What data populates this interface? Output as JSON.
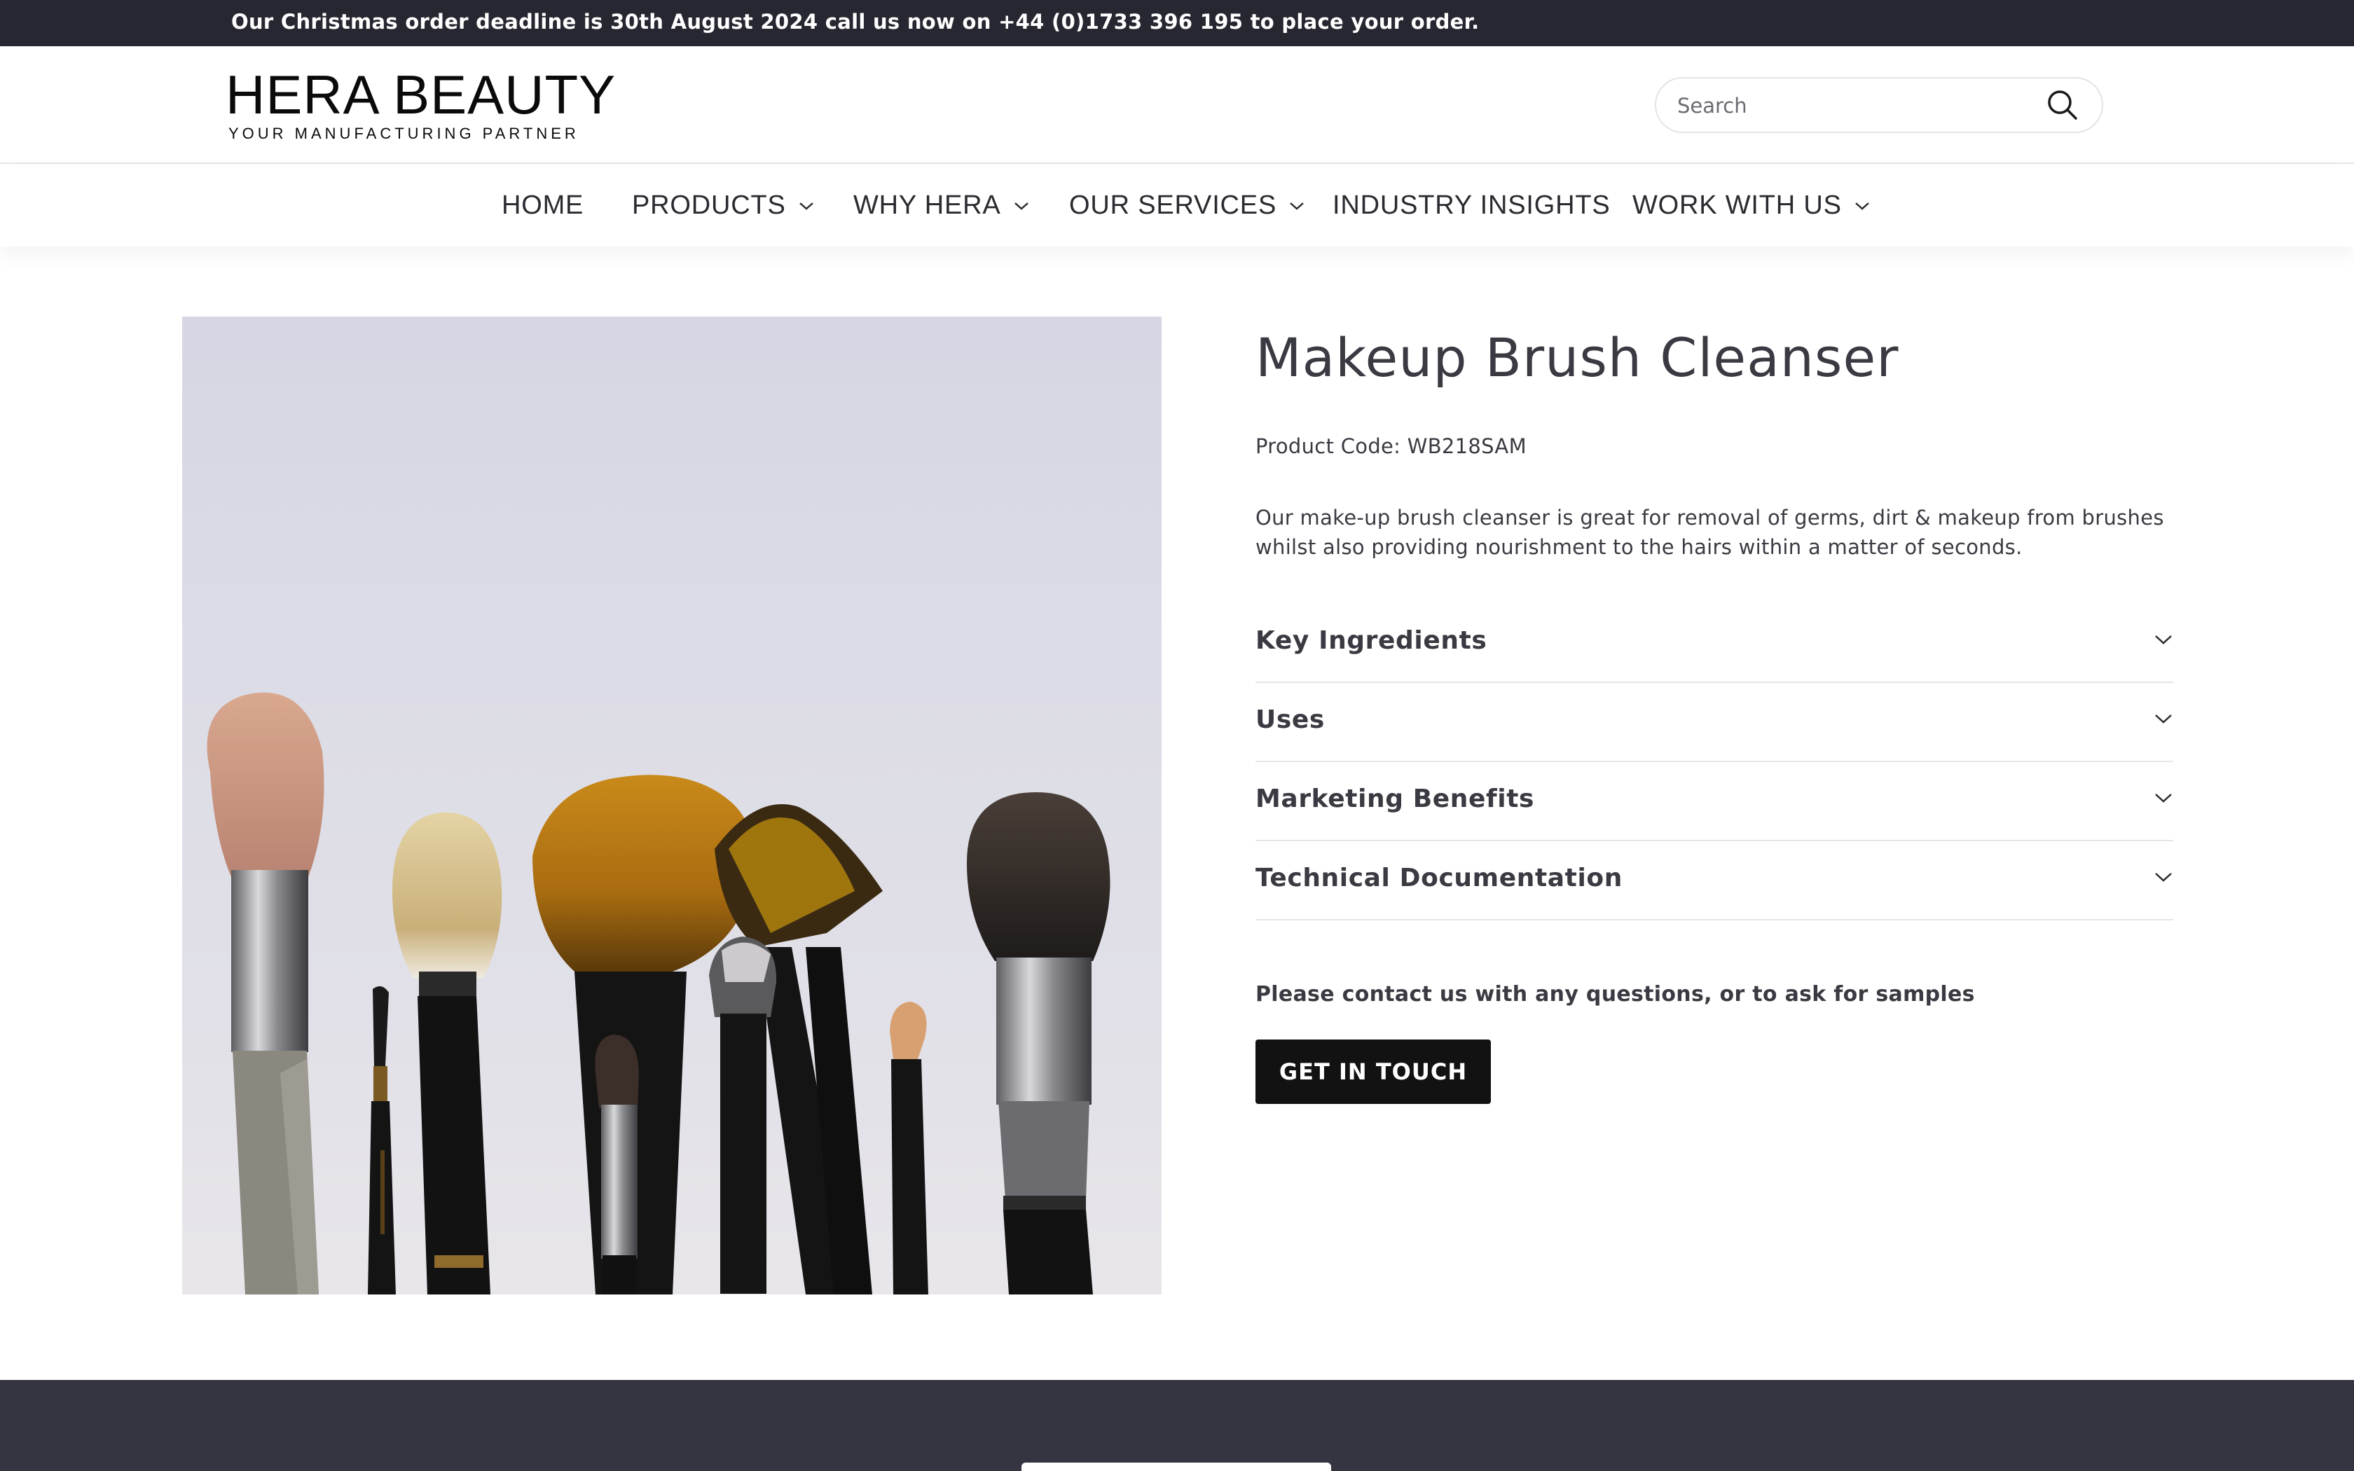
{
  "announcement": {
    "text": "Our Christmas order deadline is 30th August 2024 call us now on +44 (0)1733 396 195 to place your order."
  },
  "header": {
    "logo_main": "HERA BEAUTY",
    "logo_sub": "YOUR MANUFACTURING PARTNER",
    "search_placeholder": "Search",
    "search_icon": "search-icon"
  },
  "nav": {
    "items": [
      {
        "label": "HOME",
        "has_dropdown": false
      },
      {
        "label": "PRODUCTS",
        "has_dropdown": true
      },
      {
        "label": "WHY HERA",
        "has_dropdown": true
      },
      {
        "label": "OUR SERVICES",
        "has_dropdown": true
      },
      {
        "label": "INDUSTRY INSIGHTS",
        "has_dropdown": false
      },
      {
        "label": "WORK WITH US",
        "has_dropdown": true
      }
    ]
  },
  "product": {
    "title": "Makeup Brush Cleanser",
    "code": "Product Code: WB218SAM",
    "description": "Our make-up brush cleanser is great for removal of germs, dirt & makeup from brushes whilst also providing nourishment to the hairs within a matter of seconds.",
    "accordion": [
      {
        "label": "Key Ingredients"
      },
      {
        "label": "Uses"
      },
      {
        "label": "Marketing Benefits"
      },
      {
        "label": "Technical Documentation"
      }
    ],
    "contact_text": "Please contact us with any questions, or to ask for samples",
    "cta_label": "GET IN TOUCH"
  },
  "colors": {
    "announcement_bg": "#262730",
    "footer_bg": "#343541",
    "button_bg": "#121212",
    "text": "#3a3a42"
  }
}
